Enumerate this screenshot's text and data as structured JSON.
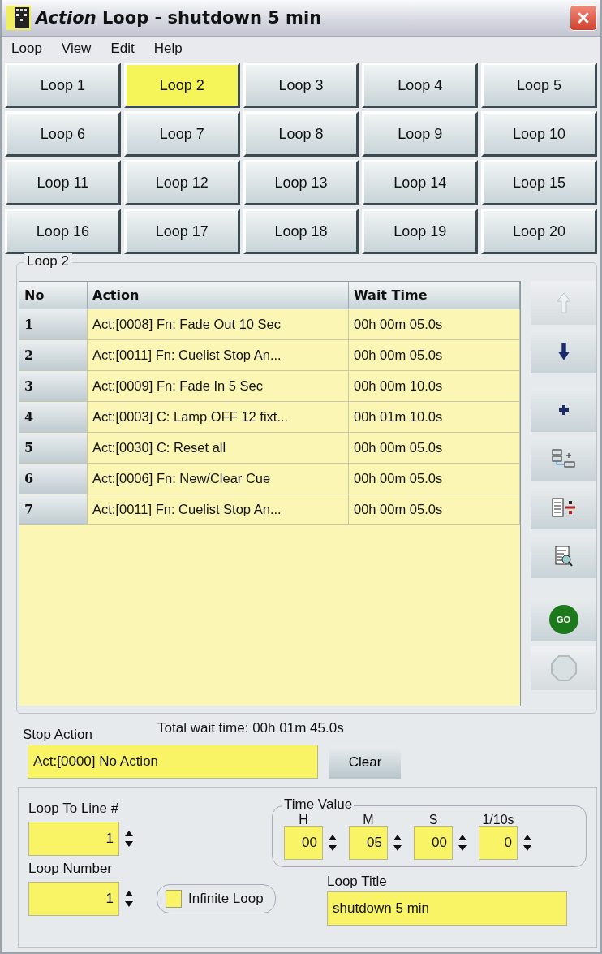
{
  "window": {
    "title_italic": "Action",
    "title": "Loop - shutdown 5 min"
  },
  "menu": [
    "Loop",
    "View",
    "Edit",
    "Help"
  ],
  "loops": [
    {
      "label": "Loop 1",
      "selected": false
    },
    {
      "label": "Loop 2",
      "selected": true
    },
    {
      "label": "Loop 3",
      "selected": false
    },
    {
      "label": "Loop 4",
      "selected": false
    },
    {
      "label": "Loop 5",
      "selected": false
    },
    {
      "label": "Loop 6",
      "selected": false
    },
    {
      "label": "Loop 7",
      "selected": false
    },
    {
      "label": "Loop 8",
      "selected": false
    },
    {
      "label": "Loop 9",
      "selected": false
    },
    {
      "label": "Loop 10",
      "selected": false
    },
    {
      "label": "Loop 11",
      "selected": false
    },
    {
      "label": "Loop 12",
      "selected": false
    },
    {
      "label": "Loop 13",
      "selected": false
    },
    {
      "label": "Loop 14",
      "selected": false
    },
    {
      "label": "Loop 15",
      "selected": false
    },
    {
      "label": "Loop 16",
      "selected": false
    },
    {
      "label": "Loop 17",
      "selected": false
    },
    {
      "label": "Loop 18",
      "selected": false
    },
    {
      "label": "Loop 19",
      "selected": false
    },
    {
      "label": "Loop 20",
      "selected": false
    }
  ],
  "group_title": "Loop 2",
  "table": {
    "columns": [
      "No",
      "Action",
      "Wait Time"
    ],
    "rows": [
      [
        "1",
        "Act:[0008] Fn: Fade Out 10 Sec",
        "00h 00m 05.0s"
      ],
      [
        "2",
        "Act:[0011] Fn: Cuelist Stop An...",
        "00h 00m 05.0s"
      ],
      [
        "3",
        "Act:[0009] Fn: Fade In 5 Sec",
        "00h 00m 10.0s"
      ],
      [
        "4",
        "Act:[0003] C: Lamp OFF 12 fixt...",
        "00h 01m 10.0s"
      ],
      [
        "5",
        "Act:[0030] C: Reset all",
        "00h 00m 05.0s"
      ],
      [
        "6",
        "Act:[0006] Fn: New/Clear Cue",
        "00h 00m 05.0s"
      ],
      [
        "7",
        "Act:[0011] Fn: Cuelist Stop An...",
        "00h 00m 05.0s"
      ]
    ]
  },
  "side_buttons": [
    {
      "kind": "up",
      "disabled": true
    },
    {
      "kind": "down",
      "disabled": false
    },
    {
      "kind": "add",
      "disabled": false
    },
    {
      "kind": "insert",
      "disabled": false
    },
    {
      "kind": "delete",
      "disabled": false
    },
    {
      "kind": "preview",
      "disabled": false
    },
    {
      "kind": "go",
      "disabled": false,
      "label": "GO"
    },
    {
      "kind": "stop",
      "disabled": true
    }
  ],
  "stop_action": {
    "label": "Stop Action",
    "value": "Act:[0000] No Action",
    "clear": "Clear"
  },
  "total": "Total wait time: 00h 01m 45.0s",
  "loop_to_line": {
    "label": "Loop To Line #",
    "value": "1"
  },
  "loop_number": {
    "label": "Loop Number",
    "value": "1"
  },
  "infinite_loop": {
    "label": "Infinite Loop",
    "checked": false
  },
  "time_value": {
    "title": "Time Value",
    "fields": [
      {
        "label": "H",
        "value": "00"
      },
      {
        "label": "M",
        "value": "05"
      },
      {
        "label": "S",
        "value": "00"
      },
      {
        "label": "1/10s",
        "value": "0"
      }
    ]
  },
  "loop_title": {
    "label": "Loop Title",
    "value": "shutdown 5 min"
  }
}
